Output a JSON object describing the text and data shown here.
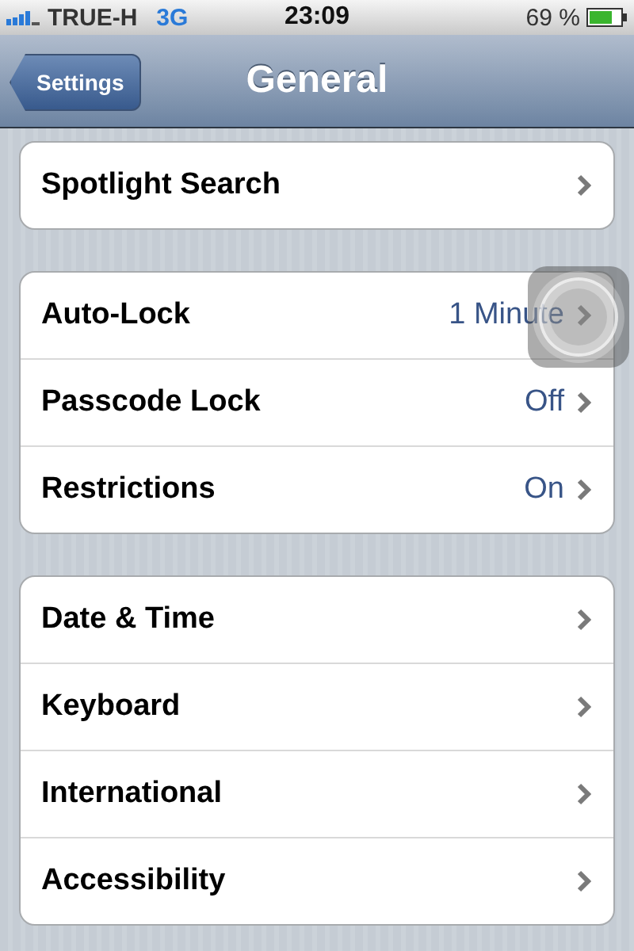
{
  "status_bar": {
    "carrier": "TRUE-H",
    "network": "3G",
    "time": "23:09",
    "battery": "69 %"
  },
  "nav_bar": {
    "back_button": "Settings",
    "title": "General"
  },
  "groups": [
    {
      "rows": [
        {
          "label": "Spotlight Search"
        }
      ]
    },
    {
      "rows": [
        {
          "label": "Auto-Lock",
          "value": "1 Minute"
        },
        {
          "label": "Passcode Lock",
          "value": "Off"
        },
        {
          "label": "Restrictions",
          "value": "On"
        }
      ]
    },
    {
      "rows": [
        {
          "label": "Date & Time"
        },
        {
          "label": "Keyboard"
        },
        {
          "label": "International"
        },
        {
          "label": "Accessibility"
        }
      ]
    }
  ]
}
